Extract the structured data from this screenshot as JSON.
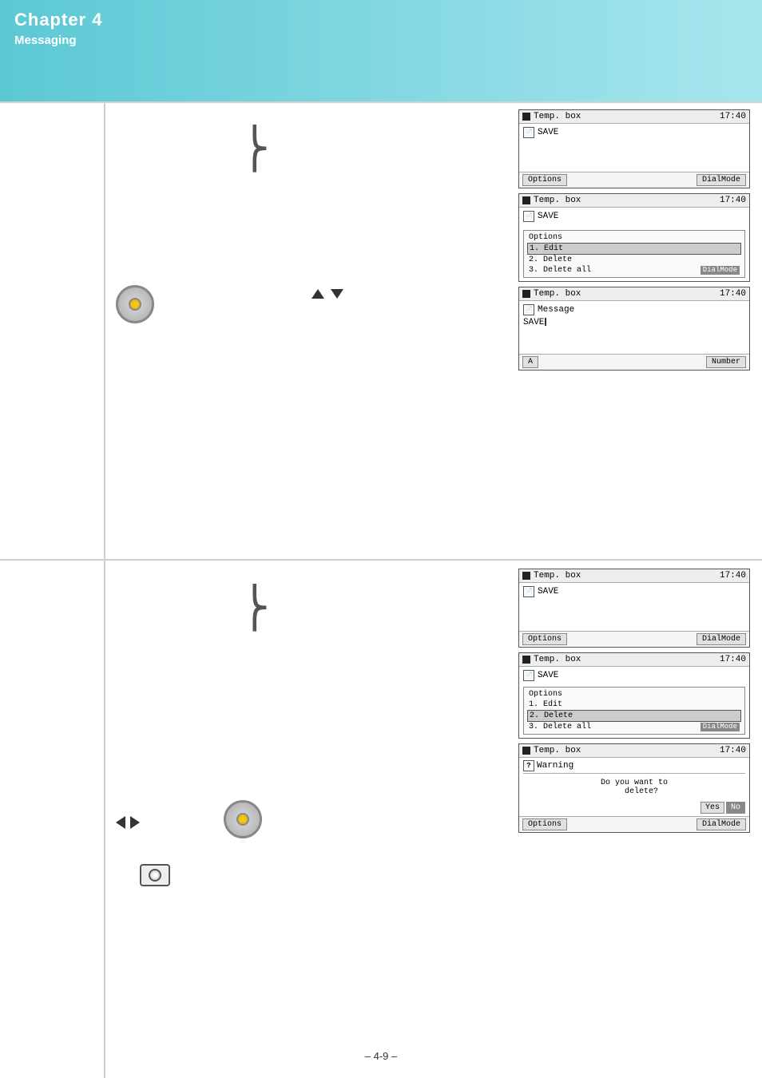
{
  "header": {
    "chapter": "Chapter 4",
    "subtitle": "Messaging"
  },
  "page_number": "– 4-9 –",
  "section_top": {
    "screens": [
      {
        "id": "s1",
        "title": "Temp. box",
        "time": "17:40",
        "body_rows": [
          {
            "icon": "doc",
            "text": "SAVE"
          }
        ],
        "softkeys": [
          "Options",
          "DialMode"
        ]
      },
      {
        "id": "s2",
        "title": "Temp. box",
        "time": "17:40",
        "body_rows": [
          {
            "icon": "doc",
            "text": "SAVE"
          }
        ],
        "options": [
          "Options",
          "1. Edit",
          "2. Delete",
          "3. Delete all"
        ],
        "softkey_right": "DialMode"
      },
      {
        "id": "s3",
        "title": "Temp. box",
        "time": "17:40",
        "body_rows": [
          {
            "icon": "doc",
            "text": "Message"
          },
          {
            "text": "SAVE",
            "cursor": true
          }
        ],
        "softkeys": [
          "A",
          "Number"
        ]
      }
    ]
  },
  "section_bottom": {
    "screens": [
      {
        "id": "b1",
        "title": "Temp. box",
        "time": "17:40",
        "body_rows": [
          {
            "icon": "doc",
            "text": "SAVE"
          }
        ],
        "softkeys": [
          "Options",
          "DialMode"
        ]
      },
      {
        "id": "b2",
        "title": "Temp. box",
        "time": "17:40",
        "body_rows": [
          {
            "icon": "doc",
            "text": "SAVE"
          }
        ],
        "options": [
          "Options",
          "1. Edit",
          "2. Delete",
          "3. Delete all"
        ],
        "softkey_right": "DialMode"
      },
      {
        "id": "b3",
        "title": "Temp. box",
        "time": "17:40",
        "warning": {
          "title": "Warning",
          "message": "Do you want to\n   delete?",
          "buttons": [
            "Yes",
            "No"
          ]
        },
        "softkeys": [
          "Options",
          "DialMode"
        ]
      }
    ]
  },
  "nav": {
    "up_down_label": "▲▼",
    "left_right_label": "◄►"
  }
}
